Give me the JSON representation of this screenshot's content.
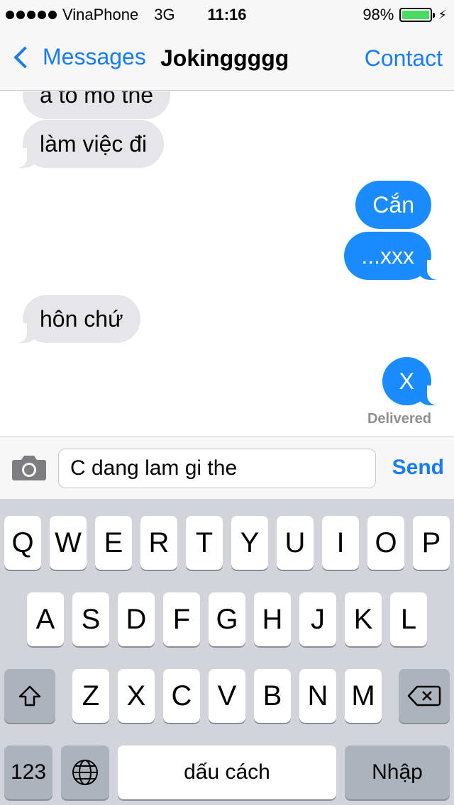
{
  "status_bar": {
    "carrier": "VinaPhone",
    "network": "3G",
    "time": "11:16",
    "battery_percent": "98%",
    "battery_level": 0.98
  },
  "nav": {
    "back_label": "Messages",
    "title": "Jokinggggg",
    "contact_label": "Contact"
  },
  "messages": [
    {
      "text": "a to mo the",
      "direction": "incoming"
    },
    {
      "text": "làm việc đi",
      "direction": "incoming"
    },
    {
      "text": "Cắn",
      "direction": "outgoing"
    },
    {
      "text": "...xxx",
      "direction": "outgoing"
    },
    {
      "text": "hôn chứ",
      "direction": "incoming"
    },
    {
      "text": "X",
      "direction": "outgoing"
    }
  ],
  "delivered_label": "Delivered",
  "composer": {
    "value": "C dang lam gi the",
    "send_label": "Send"
  },
  "keyboard": {
    "row1": [
      "Q",
      "W",
      "E",
      "R",
      "T",
      "Y",
      "U",
      "I",
      "O",
      "P"
    ],
    "row2": [
      "A",
      "S",
      "D",
      "F",
      "G",
      "H",
      "J",
      "K",
      "L"
    ],
    "row3": [
      "Z",
      "X",
      "C",
      "V",
      "B",
      "N",
      "M"
    ],
    "numbers_label": "123",
    "space_label": "dấu cách",
    "return_label": "Nhập"
  },
  "colors": {
    "accent": "#1a7cf5",
    "outgoing_bubble": "#1a8cff",
    "incoming_bubble": "#e5e5ea",
    "battery": "#4cd964"
  }
}
